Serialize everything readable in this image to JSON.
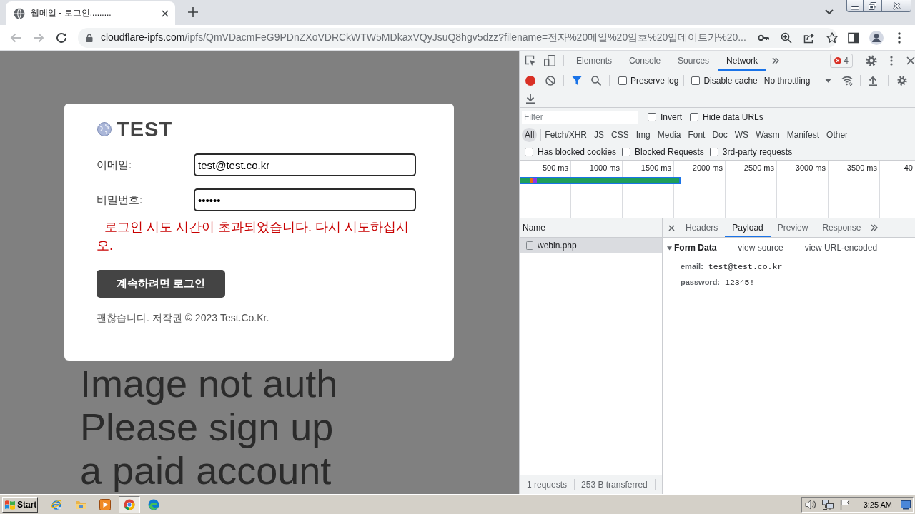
{
  "browser": {
    "tabs": [
      {
        "title": "웹메일 - 로그인.........",
        "selected": true
      }
    ],
    "address": {
      "domain": "cloudflare-ipfs.com",
      "path": "/ipfs/QmVDacmFeG9PDnZXoVDRCkWTW5MDkaxVQyJsuQ8hgv5dzz?filename=전자%20메일%20암호%20업데이트가%20..."
    }
  },
  "page": {
    "background_text": [
      "Image not auth",
      "Please sign up",
      "a paid account"
    ],
    "login": {
      "logo": "TEST",
      "fields": [
        {
          "label": "이메일:",
          "value": "test@test.co.kr"
        },
        {
          "label": "비밀번호:",
          "value": "••••••"
        }
      ],
      "error": "로그인 시도 시간이 초과되었습니다. 다시 시도하십시오.",
      "button": "계속하려면 로그인",
      "footer": "괜찮습니다. 저작권 © 2023 Test.Co.Kr."
    }
  },
  "devtools": {
    "tabs": [
      {
        "label": "Elements",
        "selected": false
      },
      {
        "label": "Console",
        "selected": false
      },
      {
        "label": "Sources",
        "selected": false
      },
      {
        "label": "Network",
        "selected": true
      }
    ],
    "error_count": "4",
    "toolbar": {
      "checkboxes": [
        {
          "label": "Preserve log",
          "checked": false
        },
        {
          "label": "Disable cache",
          "checked": false
        }
      ],
      "throttling": "No throttling"
    },
    "filter": {
      "placeholder": "Filter",
      "checkboxes": [
        {
          "label": "Invert",
          "checked": false
        },
        {
          "label": "Hide data URLs",
          "checked": false
        }
      ]
    },
    "types": [
      {
        "label": "All",
        "selected": true
      },
      {
        "label": "Fetch/XHR",
        "selected": false
      },
      {
        "label": "JS",
        "selected": false
      },
      {
        "label": "CSS",
        "selected": false
      },
      {
        "label": "Img",
        "selected": false
      },
      {
        "label": "Media",
        "selected": false
      },
      {
        "label": "Font",
        "selected": false
      },
      {
        "label": "Doc",
        "selected": false
      },
      {
        "label": "WS",
        "selected": false
      },
      {
        "label": "Wasm",
        "selected": false
      },
      {
        "label": "Manifest",
        "selected": false
      },
      {
        "label": "Other",
        "selected": false
      }
    ],
    "options": [
      {
        "label": "Has blocked cookies",
        "checked": false
      },
      {
        "label": "Blocked Requests",
        "checked": false
      },
      {
        "label": "3rd-party requests",
        "checked": false
      }
    ],
    "overview": {
      "ticks": [
        "500 ms",
        "1000 ms",
        "1500 ms",
        "2000 ms",
        "2500 ms",
        "3000 ms",
        "3500 ms",
        "40"
      ]
    },
    "requests": {
      "column": "Name",
      "rows": [
        {
          "name": "webin.php",
          "selected": true
        }
      ],
      "status": [
        "1 requests",
        "253 B transferred"
      ]
    },
    "details": {
      "tabs": [
        {
          "label": "Headers",
          "selected": false
        },
        {
          "label": "Payload",
          "selected": true
        },
        {
          "label": "Preview",
          "selected": false
        },
        {
          "label": "Response",
          "selected": false
        }
      ],
      "section": {
        "title": "Form Data",
        "expanded": true,
        "links": [
          "view source",
          "view URL-encoded"
        ],
        "fields": [
          {
            "key": "email:",
            "value": "test@test.co.kr"
          },
          {
            "key": "password:",
            "value": "12345!"
          }
        ]
      }
    }
  },
  "taskbar": {
    "start": "Start",
    "apps": [
      {
        "kind": "ie",
        "selected": false
      },
      {
        "kind": "folder",
        "selected": false
      },
      {
        "kind": "media",
        "selected": false
      },
      {
        "kind": "chrome",
        "selected": true
      },
      {
        "kind": "edge",
        "selected": false
      }
    ],
    "clock": "3:25 AM"
  }
}
